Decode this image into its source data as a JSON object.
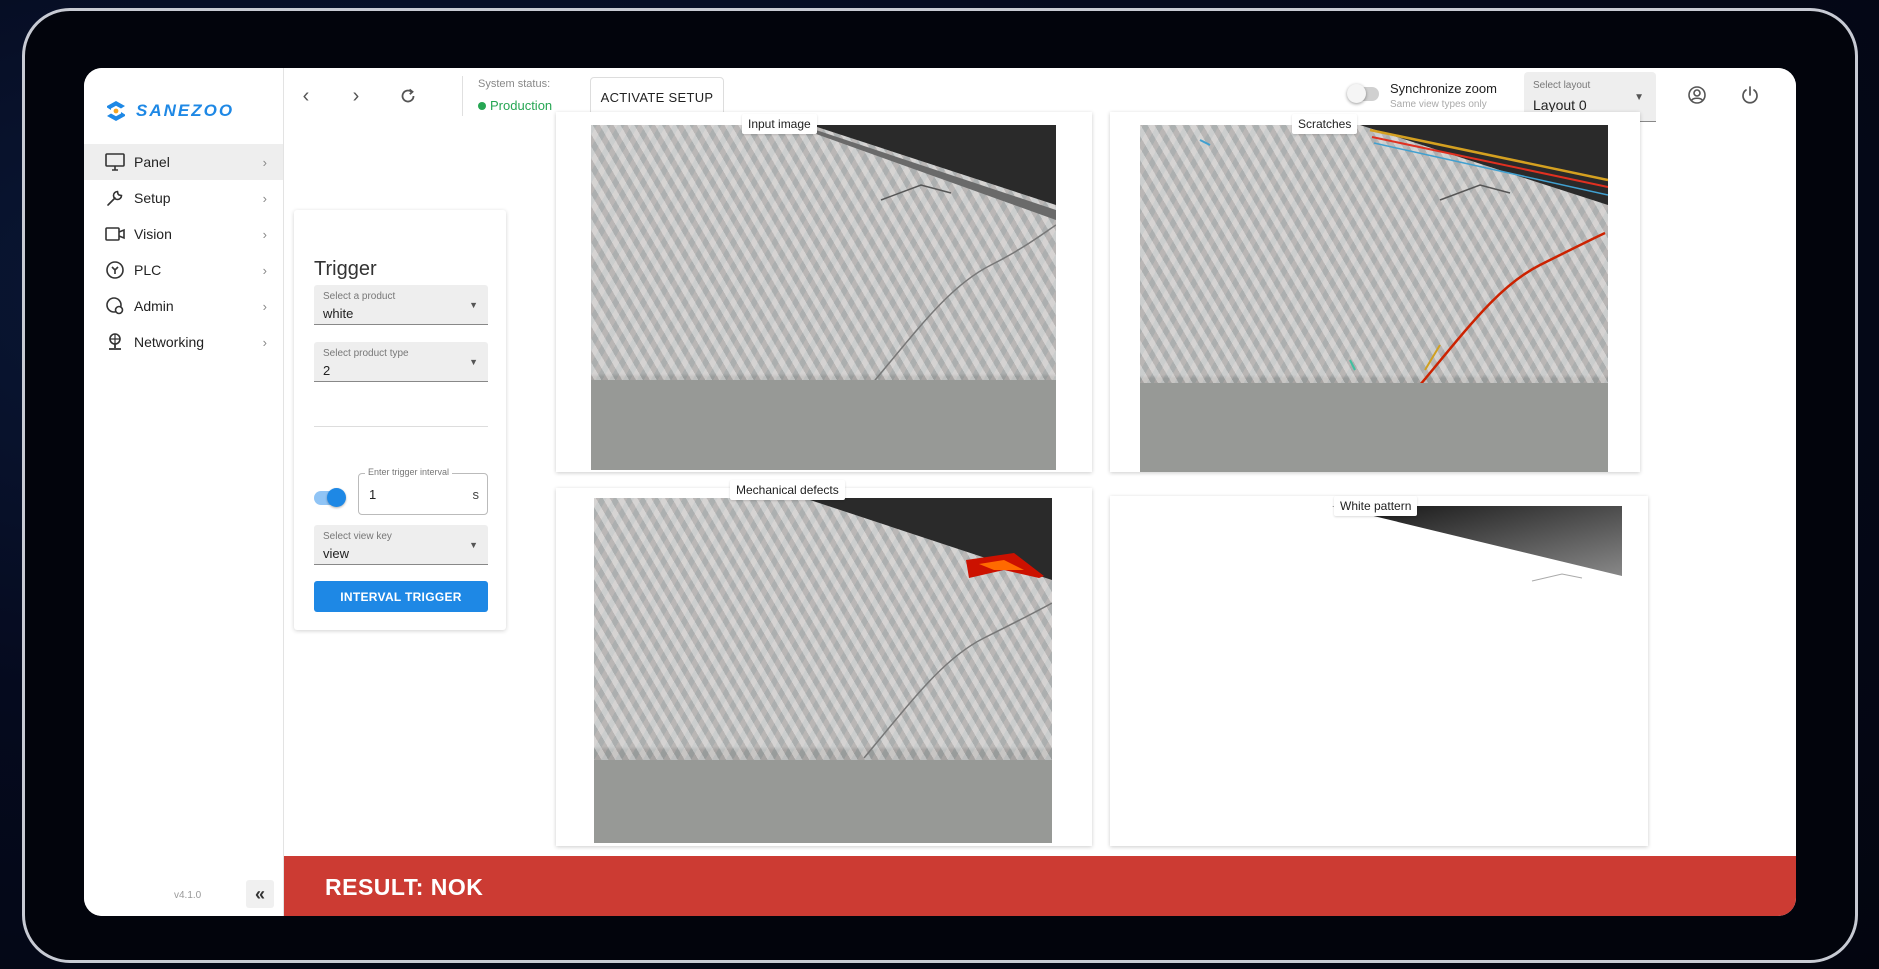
{
  "brand": {
    "name": "SANEZOO"
  },
  "sidebar": {
    "items": [
      {
        "label": "Panel",
        "icon": "monitor-icon",
        "active": true
      },
      {
        "label": "Setup",
        "icon": "wrench-icon"
      },
      {
        "label": "Vision",
        "icon": "camera-icon"
      },
      {
        "label": "PLC",
        "icon": "plc-icon"
      },
      {
        "label": "Admin",
        "icon": "admin-icon"
      },
      {
        "label": "Networking",
        "icon": "network-icon"
      }
    ],
    "version": "v4.1.0"
  },
  "topbar": {
    "system_status_label": "System status:",
    "system_status_value": "Production",
    "activate_button": "ACTIVATE SETUP",
    "sync_zoom_label": "Synchronize zoom",
    "sync_zoom_sub": "Same view types only",
    "layout_select_label": "Select layout",
    "layout_select_value": "Layout 0"
  },
  "trigger": {
    "title": "Trigger",
    "product_label": "Select a product",
    "product_value": "white",
    "product_type_label": "Select product type",
    "product_type_value": "2",
    "interval_label": "Enter trigger interval",
    "interval_value": "1",
    "interval_unit": "s",
    "view_key_label": "Select view key",
    "view_key_value": "view",
    "interval_button": "INTERVAL TRIGGER"
  },
  "views": [
    {
      "title": "Input image"
    },
    {
      "title": "Scratches"
    },
    {
      "title": "Mechanical defects"
    },
    {
      "title": "White pattern"
    }
  ],
  "result": {
    "text": "RESULT: NOK"
  },
  "colors": {
    "accent": "#1e88e5",
    "status_ok": "#26a653",
    "result_nok": "#cc3b33"
  }
}
